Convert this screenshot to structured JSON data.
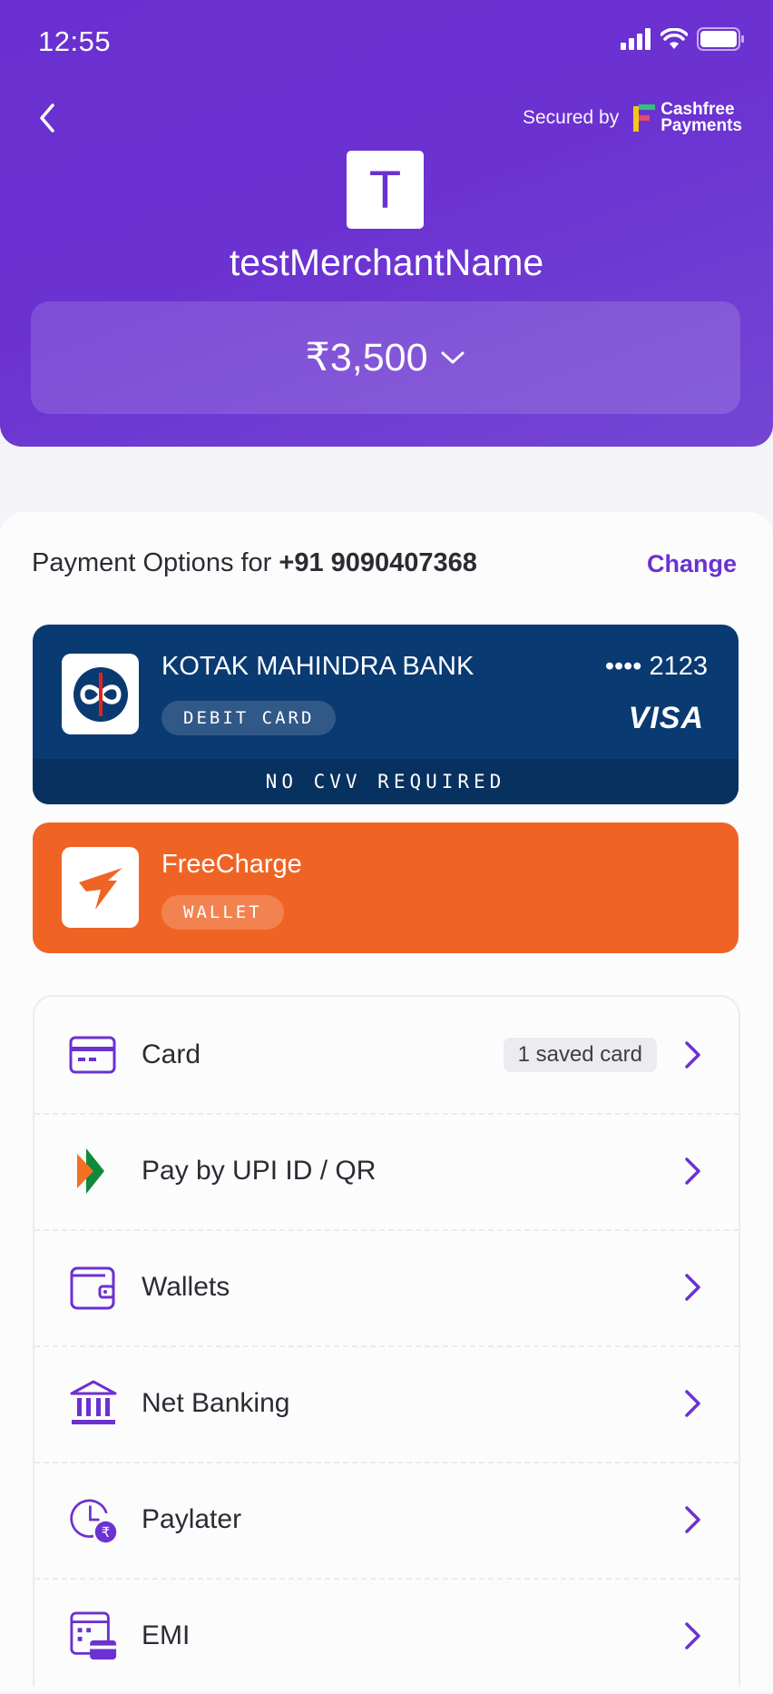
{
  "status_bar": {
    "time": "12:55"
  },
  "header": {
    "secured_by": "Secured by",
    "brand_line1": "Cashfree",
    "brand_line2": "Payments",
    "merchant_initial": "T",
    "merchant_name": "testMerchantName",
    "amount": "₹3,500"
  },
  "payment_options": {
    "label_prefix": "Payment Options for",
    "phone": "+91 9090407368",
    "change_label": "Change"
  },
  "saved_card": {
    "bank": "KOTAK MAHINDRA BANK",
    "type": "DEBIT CARD",
    "masked_number": "•••• 2123",
    "network": "VISA",
    "note": "NO CVV REQUIRED",
    "color": "#0a3a72"
  },
  "saved_wallet": {
    "name": "FreeCharge",
    "type": "WALLET",
    "color": "#ef6425"
  },
  "methods": [
    {
      "label": "Card",
      "badge": "1 saved card",
      "icon": "card-icon"
    },
    {
      "label": "Pay by UPI ID / QR",
      "icon": "upi-icon"
    },
    {
      "label": "Wallets",
      "icon": "wallet-icon"
    },
    {
      "label": "Net Banking",
      "icon": "bank-icon"
    },
    {
      "label": "Paylater",
      "icon": "paylater-icon"
    },
    {
      "label": "EMI",
      "icon": "emi-icon"
    }
  ],
  "colors": {
    "brand": "#6b31d1",
    "text": "#2b2b33"
  }
}
